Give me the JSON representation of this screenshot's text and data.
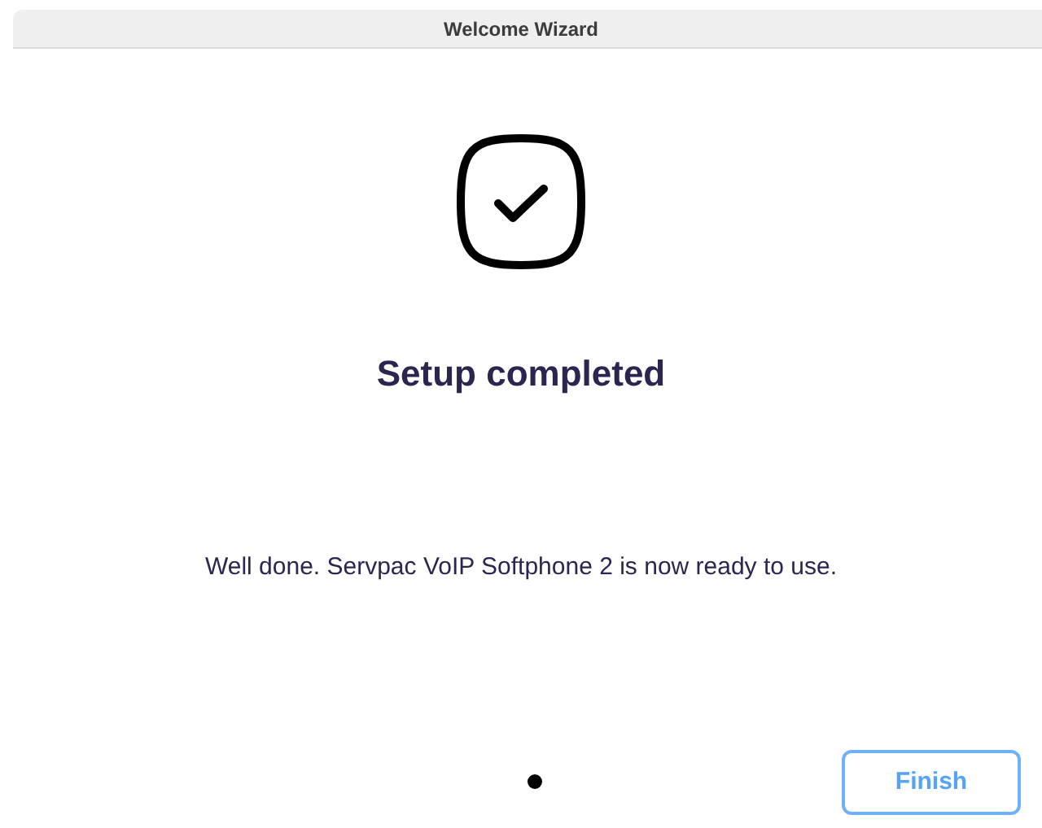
{
  "window": {
    "title": "Welcome Wizard"
  },
  "heading": "Setup completed",
  "message": "Well done. Servpac VoIP Softphone 2 is now ready to use.",
  "pages": [
    {
      "selected": true
    }
  ],
  "buttons": [
    {
      "label": "Finish"
    }
  ]
}
